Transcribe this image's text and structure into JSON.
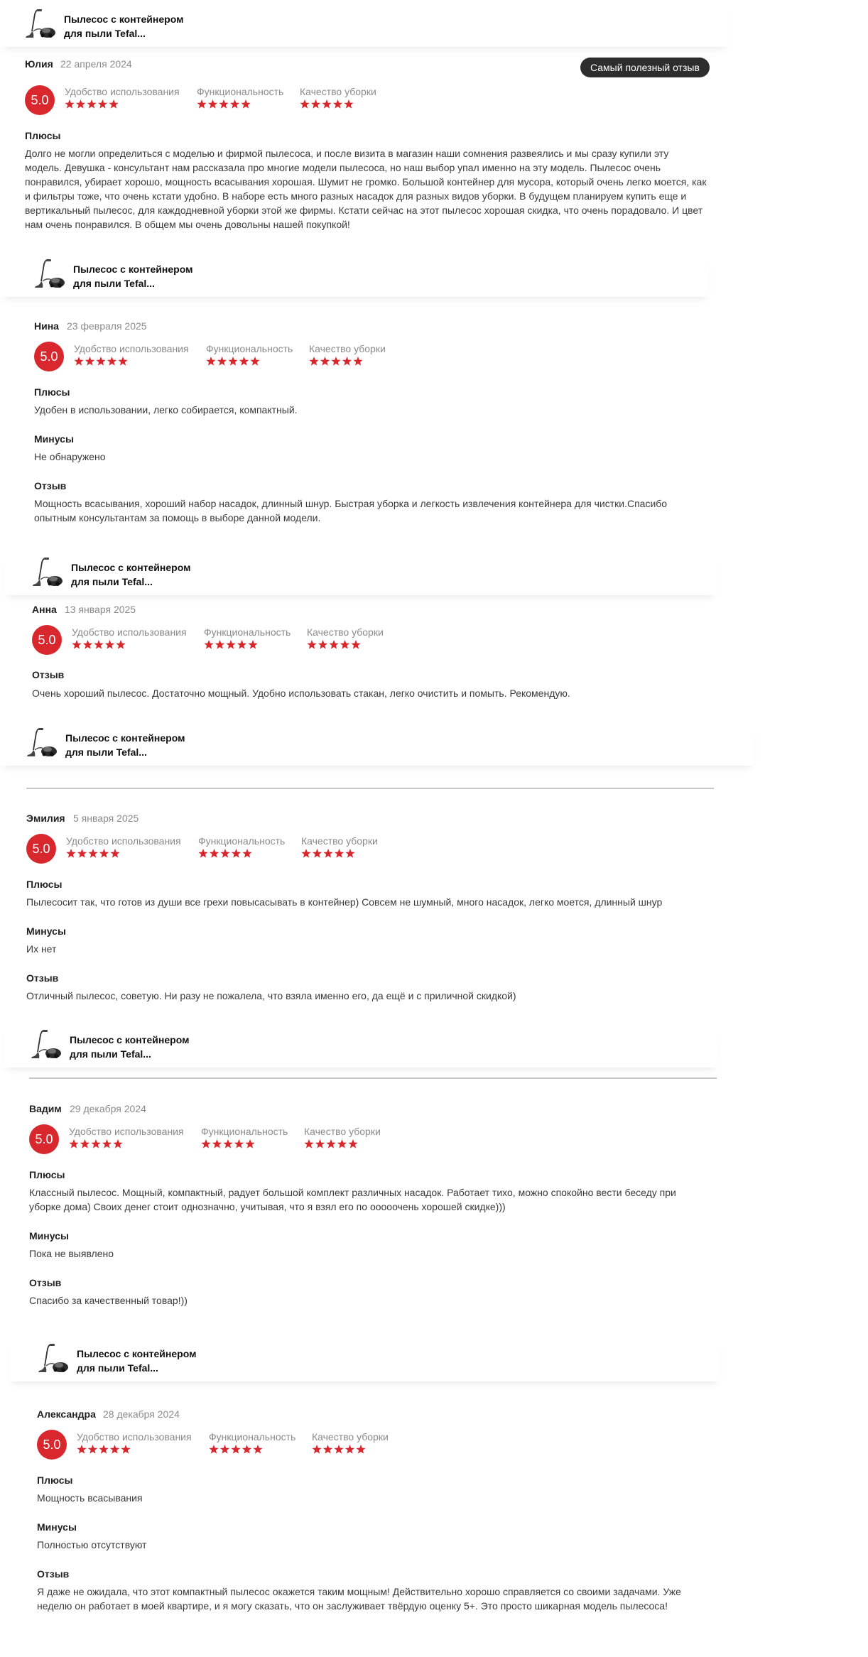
{
  "product": {
    "title": "Пылесос с контейнером для пыли Tefal...",
    "icon": "vacuum-cleaner-icon"
  },
  "rating_labels": {
    "usability": "Удобство использования",
    "functionality": "Функциональность",
    "cleaning_quality": "Качество уборки"
  },
  "section_labels": {
    "pros": "Плюсы",
    "cons": "Минусы",
    "review": "Отзыв"
  },
  "best_review_badge": "Самый полезный отзыв",
  "star_color": "#d8282e",
  "badge_color": "#d8282e",
  "reviews": [
    {
      "author": "Юлия",
      "date": "22 апреля 2024",
      "score": "5.0",
      "usability_stars": 5,
      "functionality_stars": 5,
      "cleaning_quality_stars": 5,
      "pros": "Долго не могли определиться с моделью и фирмой пылесоса, и после визита в магазин наши сомнения развеялись и мы сразу купили эту модель. Девушка - консультант нам рассказала про многие модели пылесоса, но наш выбор упал именно на эту модель. Пылесос очень понравился, убирает хорошо, мощность всасывания хорошая. Шумит не громко. Большой контейнер для мусора, который очень легко моется, как и фильтры тоже, что очень кстати удобно. В наборе есть много разных насадок для разных видов уборки. В будущем планируем купить еще и вертикальный пылесос, для каждодневной уборки этой же фирмы. Кстати сейчас на этот пылесос хорошая скидка, что очень порадовало. И цвет нам очень понравился. В общем мы очень довольны нашей покупкой!"
    },
    {
      "author": "Нина",
      "date": "23 февраля 2025",
      "score": "5.0",
      "usability_stars": 5,
      "functionality_stars": 5,
      "cleaning_quality_stars": 5,
      "pros": "Удобен в использовании, легко собирается, компактный.",
      "cons": "Не обнаружено",
      "review": "Мощность всасывания, хороший набор насадок, длинный шнур. Быстрая уборка и легкость извлечения контейнера для чистки.Спасибо опытным консультантам за помощь в выборе данной модели."
    },
    {
      "author": "Анна",
      "date": "13 января 2025",
      "score": "5.0",
      "usability_stars": 5,
      "functionality_stars": 5,
      "cleaning_quality_stars": 5,
      "review": "Очень хороший пылесос. Достаточно мощный. Удобно использовать стакан, легко очистить и помыть. Рекомендую."
    },
    {
      "author": "Эмилия",
      "date": "5 января 2025",
      "score": "5.0",
      "usability_stars": 5,
      "functionality_stars": 5,
      "cleaning_quality_stars": 5,
      "pros": "Пылесосит так, что готов из души все грехи повысасывать в контейнер) Совсем не шумный, много насадок, легко моется, длинный шнур",
      "cons": "Их нет",
      "review": "Отличный пылесос, советую. Ни разу не пожалела, что взяла именно его, да ещё и с приличной скидкой)"
    },
    {
      "author": "Вадим",
      "date": "29 декабря 2024",
      "score": "5.0",
      "usability_stars": 5,
      "functionality_stars": 5,
      "cleaning_quality_stars": 5,
      "pros": "Классный пылесос. Мощный, компактный, радует большой комплект различных насадок. Работает тихо, можно спокойно вести беседу при уборке дома) Своих денег стоит однозначно, учитывая, что я взял его по ооооочень хорошей скидке)))",
      "cons": "Пока не выявлено",
      "review": "Спасибо за качественный товар!))"
    },
    {
      "author": "Александра",
      "date": "28 декабря 2024",
      "score": "5.0",
      "usability_stars": 5,
      "functionality_stars": 5,
      "cleaning_quality_stars": 5,
      "pros": "Мощность всасывания",
      "cons": "Полностью отсутствуют",
      "review": "Я даже не ожидала, что этот компактный пылесос окажется таким мощным! Действительно хорошо справляется со своими задачами. Уже неделю он работает в моей квартире, и я могу сказать, что он заслуживает твёрдую оценку 5+. Это просто шикарная модель пылесоса!"
    }
  ]
}
